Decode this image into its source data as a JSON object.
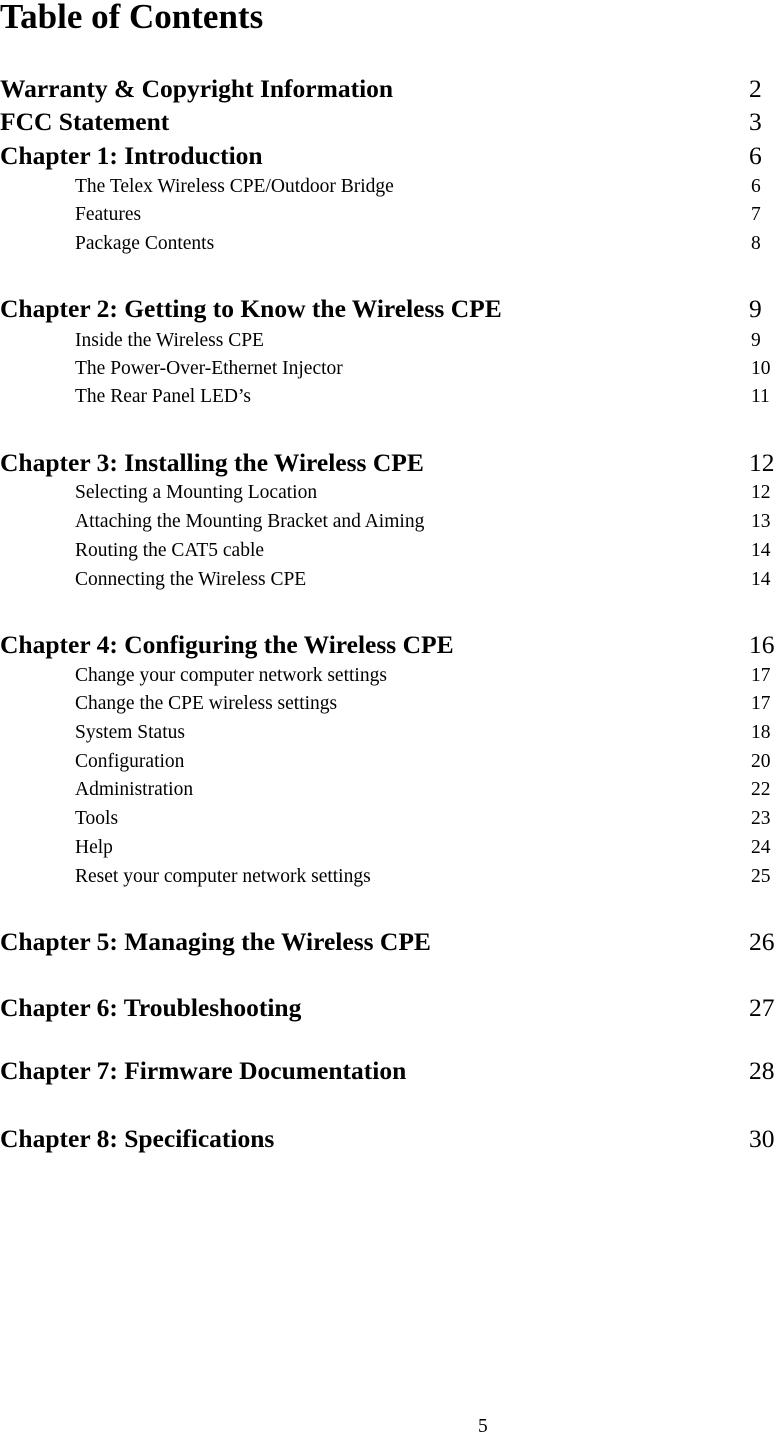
{
  "document": {
    "title": "Table of Contents",
    "page_number": "5"
  },
  "front_matter": [
    {
      "label": "Warranty & Copyright Information",
      "page": "2"
    },
    {
      "label": "FCC Statement",
      "page": "3"
    }
  ],
  "chapters": [
    {
      "label": "Chapter 1: Introduction",
      "page": "6",
      "sections": [
        {
          "label": "The Telex Wireless CPE/Outdoor Bridge",
          "page": "6"
        },
        {
          "label": "Features",
          "page": "7"
        },
        {
          "label": "Package Contents",
          "page": "8"
        }
      ]
    },
    {
      "label": "Chapter 2: Getting to Know the Wireless CPE",
      "page": "9",
      "sections": [
        {
          "label": "Inside the Wireless CPE",
          "page": "9"
        },
        {
          "label": "The Power-Over-Ethernet Injector",
          "page": "10"
        },
        {
          "label": "The Rear Panel LED’s",
          "page": "11"
        }
      ]
    },
    {
      "label": "Chapter 3: Installing the Wireless CPE",
      "page": "12",
      "sections": [
        {
          "label": "Selecting a Mounting Location",
          "page": "12"
        },
        {
          "label": "Attaching the Mounting Bracket and Aiming",
          "page": "13"
        },
        {
          "label": "Routing the CAT5 cable",
          "page": "14"
        },
        {
          "label": "Connecting the Wireless CPE",
          "page": "14"
        }
      ]
    },
    {
      "label": "Chapter 4: Configuring the Wireless CPE",
      "page": "16",
      "sections": [
        {
          "label": "Change your computer network settings",
          "page": "17"
        },
        {
          "label": "Change the CPE wireless settings",
          "page": "17"
        },
        {
          "label": "System Status",
          "page": "18"
        },
        {
          "label": "Configuration",
          "page": "20"
        },
        {
          "label": "Administration",
          "page": "22"
        },
        {
          "label": "Tools",
          "page": "23"
        },
        {
          "label": "Help",
          "page": "24"
        },
        {
          "label": "Reset your computer network settings",
          "page": "25"
        }
      ]
    },
    {
      "label": "Chapter 5: Managing the Wireless CPE",
      "page": "26",
      "sections": []
    },
    {
      "label": "Chapter 6: Troubleshooting",
      "page": "27",
      "sections": []
    },
    {
      "label": "Chapter 7: Firmware Documentation",
      "page": "28",
      "sections": []
    },
    {
      "label": "Chapter 8: Specifications",
      "page": "30",
      "sections": []
    }
  ]
}
